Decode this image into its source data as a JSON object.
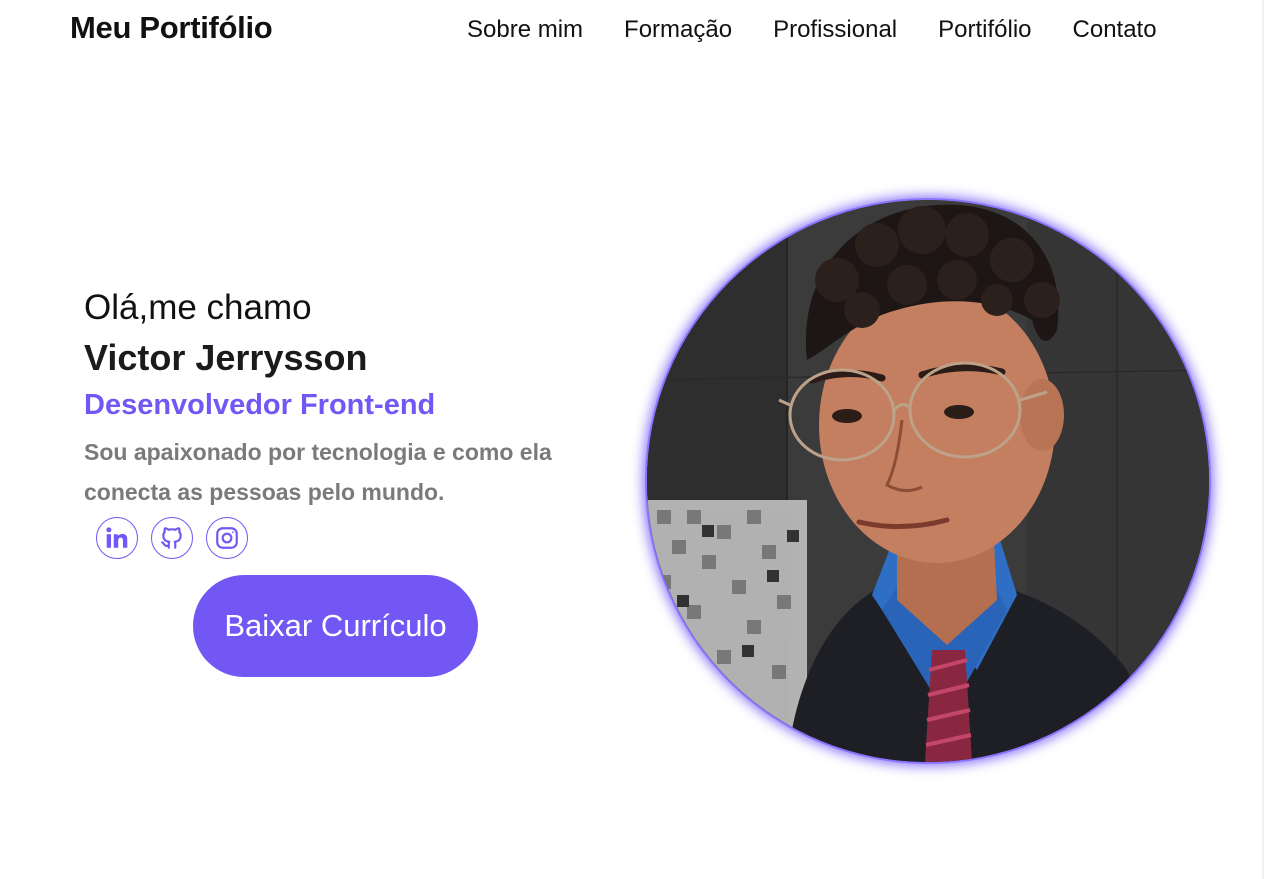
{
  "header": {
    "logo": "Meu Portifólio",
    "nav": [
      "Sobre mim",
      "Formação",
      "Profissional",
      "Portifólio",
      "Contato"
    ]
  },
  "hero": {
    "greeting": "Olá,me chamo",
    "name": "Victor Jerrysson",
    "role": "Desenvolvedor Front-end",
    "bio": "Sou apaixonado por tecnologia e como ela conecta as pessoas pelo mundo.",
    "socials": [
      {
        "icon": "linkedin-icon"
      },
      {
        "icon": "github-icon"
      },
      {
        "icon": "instagram-icon"
      }
    ],
    "cta": "Baixar Currículo"
  },
  "colors": {
    "accent": "#7257f5",
    "text": "#111111",
    "muted": "#7a7a7a",
    "background": "#ffffff"
  }
}
